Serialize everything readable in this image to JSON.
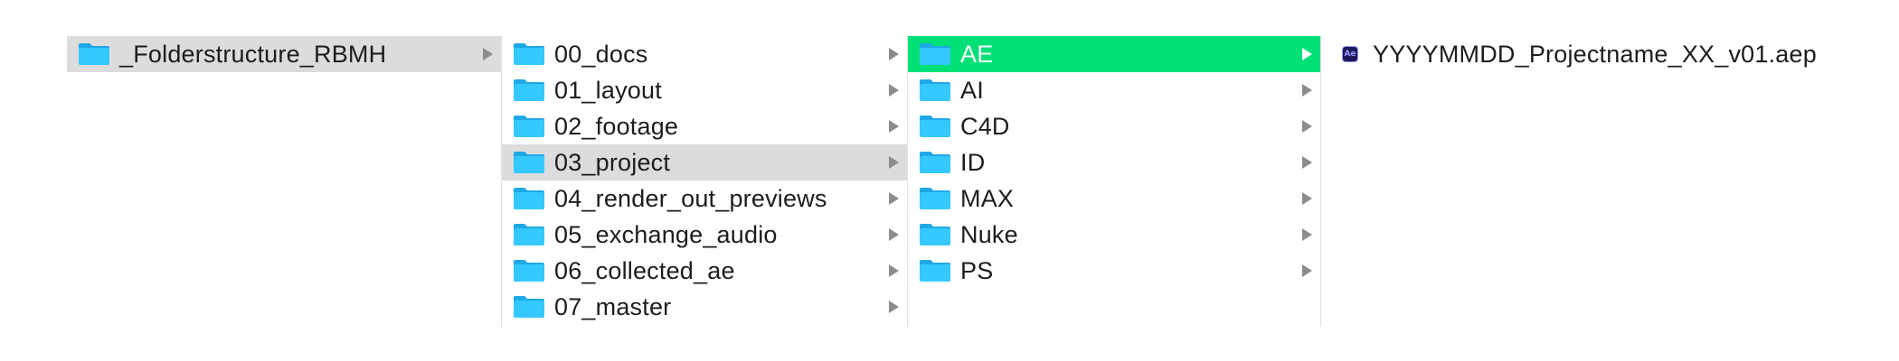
{
  "column1": {
    "items": [
      {
        "label": "_Folderstructure_RBMH",
        "icon": "folder-icon"
      }
    ]
  },
  "column2": {
    "items": [
      {
        "label": "00_docs",
        "icon": "folder-icon"
      },
      {
        "label": "01_layout",
        "icon": "folder-icon"
      },
      {
        "label": "02_footage",
        "icon": "folder-icon"
      },
      {
        "label": "03_project",
        "icon": "folder-icon"
      },
      {
        "label": "04_render_out_previews",
        "icon": "folder-icon"
      },
      {
        "label": "05_exchange_audio",
        "icon": "folder-icon"
      },
      {
        "label": "06_collected_ae",
        "icon": "folder-icon"
      },
      {
        "label": "07_master",
        "icon": "folder-icon"
      }
    ]
  },
  "column3": {
    "items": [
      {
        "label": "AE",
        "icon": "folder-icon"
      },
      {
        "label": "AI",
        "icon": "folder-icon"
      },
      {
        "label": "C4D",
        "icon": "folder-icon"
      },
      {
        "label": "ID",
        "icon": "folder-icon"
      },
      {
        "label": "MAX",
        "icon": "folder-icon"
      },
      {
        "label": "Nuke",
        "icon": "folder-icon"
      },
      {
        "label": "PS",
        "icon": "folder-icon"
      }
    ]
  },
  "column4": {
    "items": [
      {
        "label": "YYYYMMDD_Projectname_XX_v01.aep",
        "icon": "after-effects-file-icon",
        "badge": "Ae"
      }
    ]
  },
  "colors": {
    "selected_active": "#00e077",
    "selected_inactive": "#dcdcdc",
    "folder": "#34c8ff"
  }
}
